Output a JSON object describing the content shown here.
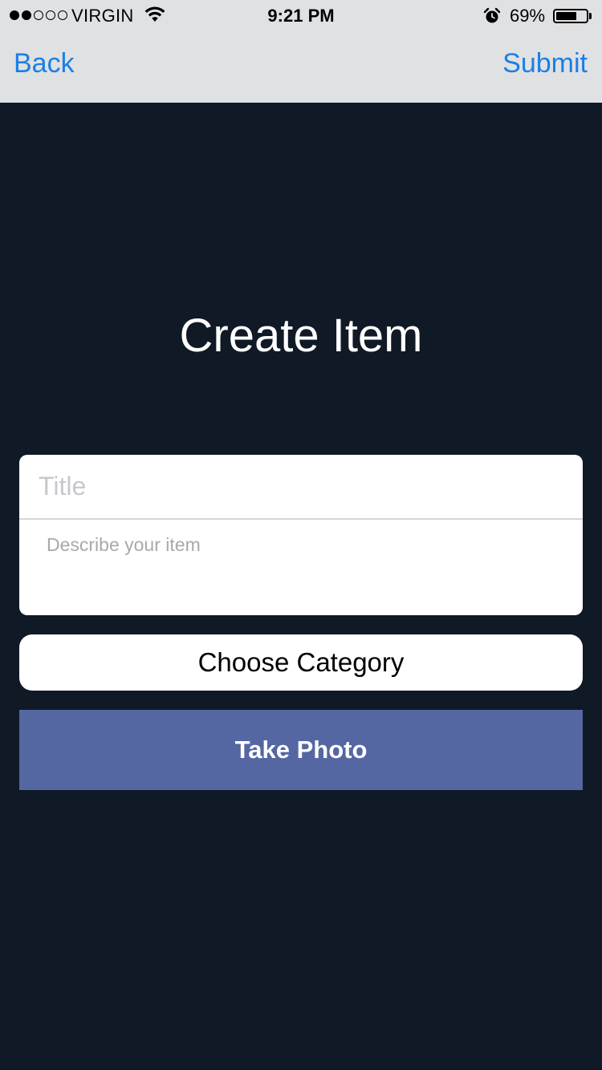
{
  "status_bar": {
    "signal_filled": 2,
    "signal_total": 5,
    "carrier": "VIRGIN",
    "wifi_icon": "wifi-icon",
    "time": "9:21 PM",
    "alarm_icon": "alarm-clock-icon",
    "battery_percent": "69%",
    "battery_level": 0.69
  },
  "nav": {
    "back_label": "Back",
    "submit_label": "Submit",
    "accent_color": "#1a7fe5"
  },
  "main": {
    "title": "Create Item",
    "title_field": {
      "value": "",
      "placeholder": "Title"
    },
    "description_field": {
      "value": "",
      "placeholder": "Describe your item"
    },
    "category_button_label": "Choose Category",
    "photo_button_label": "Take Photo"
  },
  "colors": {
    "background": "#101a26",
    "photo_button": "#5467a3",
    "nav_bar": "#e0e1e3"
  }
}
